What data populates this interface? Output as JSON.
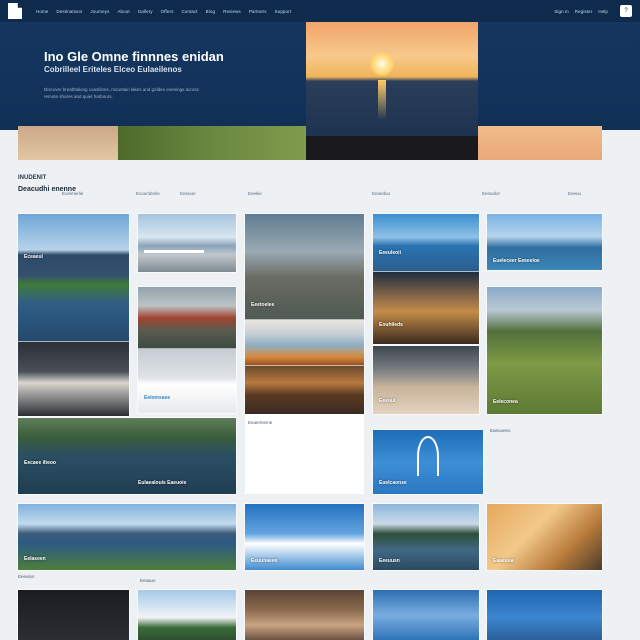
{
  "nav": {
    "items": [
      "Home",
      "Destinations",
      "Journeys",
      "About",
      "Gallery",
      "Offers",
      "Contact",
      "Blog",
      "Reviews",
      "Partners",
      "Support"
    ],
    "user_items": [
      "Sign in",
      "Register",
      "Help"
    ],
    "menu_label": "?"
  },
  "hero": {
    "title": "Ino Gle Omne finnnes enidan",
    "subtitle": "Cobrilleel Eriteles Elceo Eulaeilenos",
    "description": "Discover breathtaking coastlines, mountain lakes and golden evenings across remote shores and quiet harbours."
  },
  "section": {
    "label": "INUDENIT",
    "title": "Deacudhi enenne"
  },
  "column_headings": [
    "Eueimerlie",
    "Ecuumbmle",
    "Eeeuun",
    "Eeekie",
    "Eeaeduu",
    "Eeeuulor",
    "Eeeuu"
  ],
  "captions": {
    "c1": "Eceaeul",
    "c2": "Eelomsaee",
    "c3": "Eecaee ilteoo",
    "c4": "Eulaealouis Eaeuoie",
    "c5": "Eeetoelee",
    "c6": "Eeeuleoii",
    "c7": "Eouhileds",
    "c8": "Eeeuul",
    "c9": "Euelcaonse",
    "c10": "Eueleceer Eeeeeioe",
    "c11": "Eeleconea",
    "c12": "Eelaseen",
    "c13": "Eeuunaeee",
    "c14": "Eeeuusn",
    "c15": "Eaaeuua"
  },
  "subcaptions": {
    "s1": "Eaeuoeeo",
    "s2": "Eeeulon",
    "s3": "Eeaaun",
    "s4": "Eeaerineme"
  },
  "colors": {
    "nav_bg": "#0e2a4d",
    "hero_bg": "#14365f",
    "page_bg": "#eef1f4"
  }
}
